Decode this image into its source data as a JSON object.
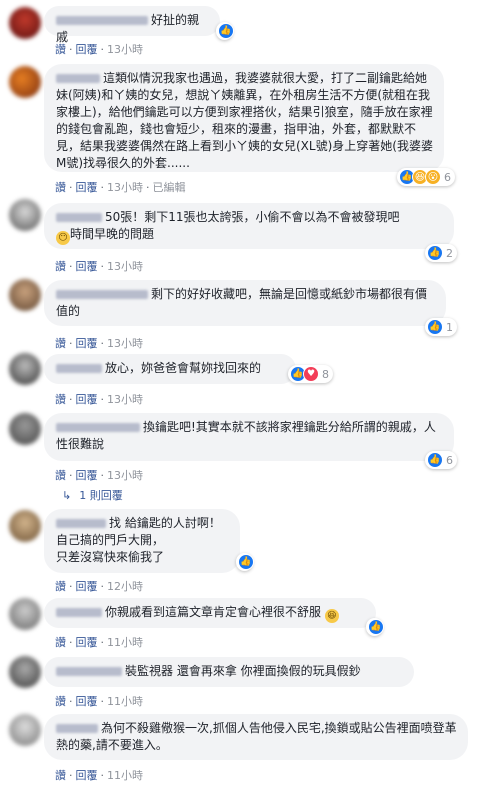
{
  "actions": {
    "like": "讚",
    "reply": "回覆",
    "edited": "已編輯"
  },
  "comments": [
    {
      "text": "好扯的親戚",
      "time": "13小時",
      "reactions": ""
    },
    {
      "text": "這類似情況我家也遇過，我婆婆就很大愛，打了二副鑰匙給她妹(阿姨)和ㄚ姨的女兒，想說ㄚ姨離異，在外租房生活不方便(就租在我家樓上)，給他們鑰匙可以方便到家裡搭伙，結果引狼室，隨手放在家裡的錢包會亂跑，錢也會短少，租來的漫畫，指甲油，外套，都默默不見，結果我婆婆偶然在路上看到小ㄚ姨的女兒(XL號)身上穿著她(我婆婆M號)找尋很久的外套......",
      "time": "13小時",
      "reactions": "6"
    },
    {
      "text": "50張！剩下11張也太誇張，小偷不會以為不會被發現吧",
      "text2": "時間早晚的問題",
      "time": "13小時",
      "reactions": "2"
    },
    {
      "text": "剩下的好好收藏吧，無論是回憶或紙鈔市場都很有價值的",
      "time": "13小時",
      "reactions": "1"
    },
    {
      "text": "放心，妳爸爸會幫妳找回來的",
      "time": "13小時",
      "reactions": "8"
    },
    {
      "text": "換鑰匙吧!其實本就不該將家裡鑰匙分給所謂的親戚，人性很難說",
      "time": "13小時",
      "reactions": "6",
      "replies": "1 則回覆"
    },
    {
      "text": "找 給鑰匙的人討啊！",
      "text2": "自己搞的門戶大開，",
      "text3": "只差沒寫快來偷我了",
      "time": "12小時",
      "reactions": ""
    },
    {
      "text": "你親戚看到這篇文章肯定會心裡很不舒服",
      "time": "11小時",
      "reactions": ""
    },
    {
      "text": "裝監視器 還會再來拿 你裡面換假的玩具假鈔",
      "time": "11小時",
      "reactions": ""
    },
    {
      "text": "為何不殺雞儆猴一次,抓個人告他侵入民宅,換鎖或貼公告裡面喷登革熱的藥,請不要進入。",
      "time": "11小時",
      "reactions": ""
    }
  ]
}
